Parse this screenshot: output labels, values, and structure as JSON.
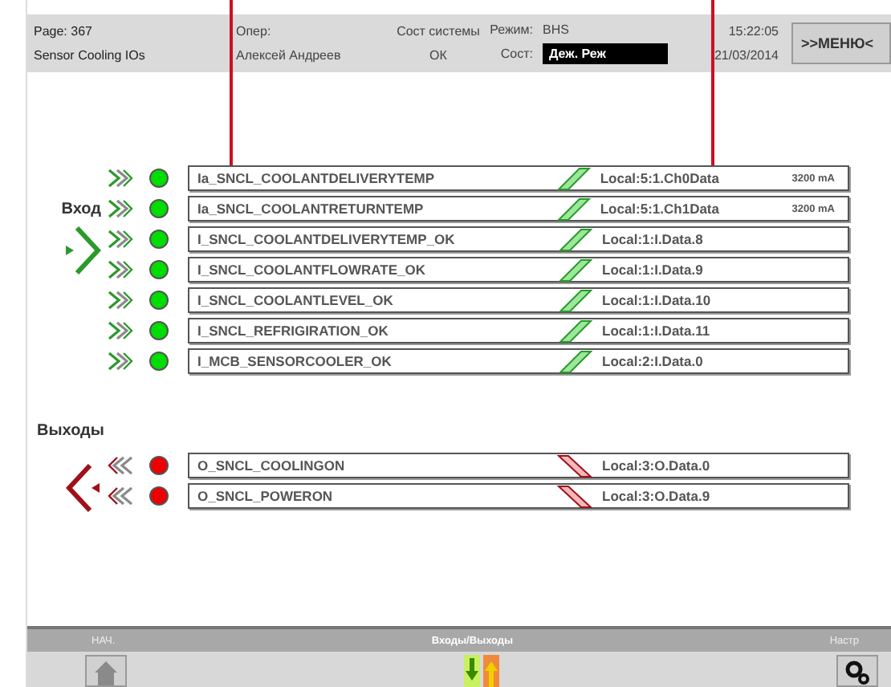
{
  "header": {
    "page": "Page: 367",
    "screen": "Sensor Cooling IOs",
    "operator_label": "Опер:",
    "operator": "Алексей Андреев",
    "system_label": "Сост системы",
    "system_state": "ОК",
    "mode_label": "Режим:",
    "mode": "BHS",
    "state_label": "Сост:",
    "state": "Деж. Реж",
    "time": "15:22:05",
    "date": "21/03/2014",
    "menu_button": ">>МЕНЮ<"
  },
  "inputs": {
    "label": "Вход",
    "rows": [
      {
        "kind": "analog",
        "tag": "Ia_SNCL_COOLANTDELIVERYTEMP",
        "address": "Local:5:1.Ch0Data",
        "reading": "3200 mA",
        "color": "#00dd00"
      },
      {
        "kind": "analog",
        "tag": "Ia_SNCL_COOLANTRETURNTEMP",
        "address": "Local:5:1.Ch1Data",
        "reading": "3200 mA",
        "color": "#00dd00"
      },
      {
        "kind": "digital",
        "tag": "I_SNCL_COOLANTDELIVERYTEMP_OK",
        "address": "Local:1:I.Data.8",
        "color": "#00dd00"
      },
      {
        "kind": "digital",
        "tag": "I_SNCL_COOLANTFLOWRATE_OK",
        "address": "Local:1:I.Data.9",
        "color": "#00dd00"
      },
      {
        "kind": "digital",
        "tag": "I_SNCL_COOLANTLEVEL_OK",
        "address": "Local:1:I.Data.10",
        "color": "#00dd00"
      },
      {
        "kind": "digital",
        "tag": "I_SNCL_REFRIGIRATION_OK",
        "address": "Local:1:I.Data.11",
        "color": "#00dd00"
      },
      {
        "kind": "digital",
        "tag": "I_MCB_SENSORCOOLER_OK",
        "address": "Local:2:I.Data.0",
        "color": "#00dd00"
      }
    ]
  },
  "outputs": {
    "label": "Выходы",
    "rows": [
      {
        "tag": "O_SNCL_COOLINGON",
        "address": "Local:3:O.Data.0",
        "color": "#ee0000"
      },
      {
        "tag": "O_SNCL_POWERON",
        "address": "Local:3:O.Data.9",
        "color": "#ee0000"
      }
    ]
  },
  "footer": {
    "tabs": [
      {
        "label": "НАЧ.",
        "kind": "home",
        "selected": false
      },
      {
        "label": "Входы/Выходы",
        "kind": "io",
        "selected": true
      },
      {
        "label": "Настр",
        "kind": "settings",
        "selected": false
      }
    ]
  }
}
